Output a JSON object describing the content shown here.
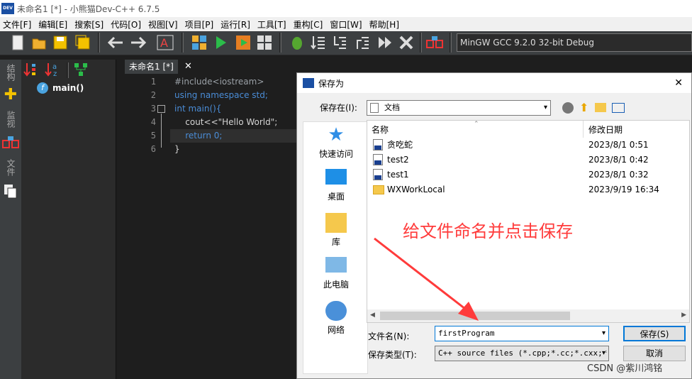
{
  "window": {
    "title": "未命名1 [*] - 小熊猫Dev-C++ 6.7.5"
  },
  "menu": [
    "文件[F]",
    "编辑[E]",
    "搜索[S]",
    "代码[O]",
    "视图[V]",
    "项目[P]",
    "运行[R]",
    "工具[T]",
    "重构[C]",
    "窗口[W]",
    "帮助[H]"
  ],
  "toolbar": {
    "compiler": "MinGW GCC 9.2.0 32-bit Debug"
  },
  "sidebar": {
    "tabs": [
      "结构",
      "监视",
      "文件"
    ],
    "tree_item": "main()"
  },
  "editor": {
    "tab_label": "未命名1 [*]",
    "tab_close": "✕",
    "line_numbers": [
      "1",
      "2",
      "3",
      "4",
      "5",
      "6"
    ],
    "lines": [
      {
        "text": "#include<iostream>",
        "color": "#9aa0a6"
      },
      {
        "text": "using namespace std;",
        "color": "#4a8cd6"
      },
      {
        "text": "int main(){",
        "color": "#4a8cd6"
      },
      {
        "text": "    cout<<\"Hello World\";",
        "color": "#d4d4d4"
      },
      {
        "text": "    return 0;",
        "color": "#4a8cd6"
      },
      {
        "text": "}",
        "color": "#d4d4d4"
      }
    ]
  },
  "dialog": {
    "title": "保存为",
    "close": "✕",
    "save_in_label": "保存在(I):",
    "save_in_value": "文档",
    "places": [
      "快速访问",
      "桌面",
      "库",
      "此电脑",
      "网络"
    ],
    "col_name": "名称",
    "col_date": "修改日期",
    "files": [
      {
        "name": "贪吃蛇",
        "date": "2023/8/1 0:51",
        "type": "file"
      },
      {
        "name": "test2",
        "date": "2023/8/1 0:42",
        "type": "file"
      },
      {
        "name": "test1",
        "date": "2023/8/1 0:32",
        "type": "file"
      },
      {
        "name": "WXWorkLocal",
        "date": "2023/9/19 16:34",
        "type": "folder"
      }
    ],
    "filename_label": "文件名(N):",
    "filename_value": "firstProgram",
    "filetype_label": "保存类型(T):",
    "filetype_value": "C++ source files (*.cpp;*.cc;*.cxx;*.",
    "save_button": "保存(S)",
    "cancel_button": "取消"
  },
  "annotation": "给文件命名并点击保存",
  "watermark": "CSDN @紫川鸿铭",
  "colors": {
    "accent": "#0078d7",
    "arrow": "#ff3b3b",
    "toolbar_bg": "#3c3f41",
    "editor_bg": "#1e1e1e"
  }
}
